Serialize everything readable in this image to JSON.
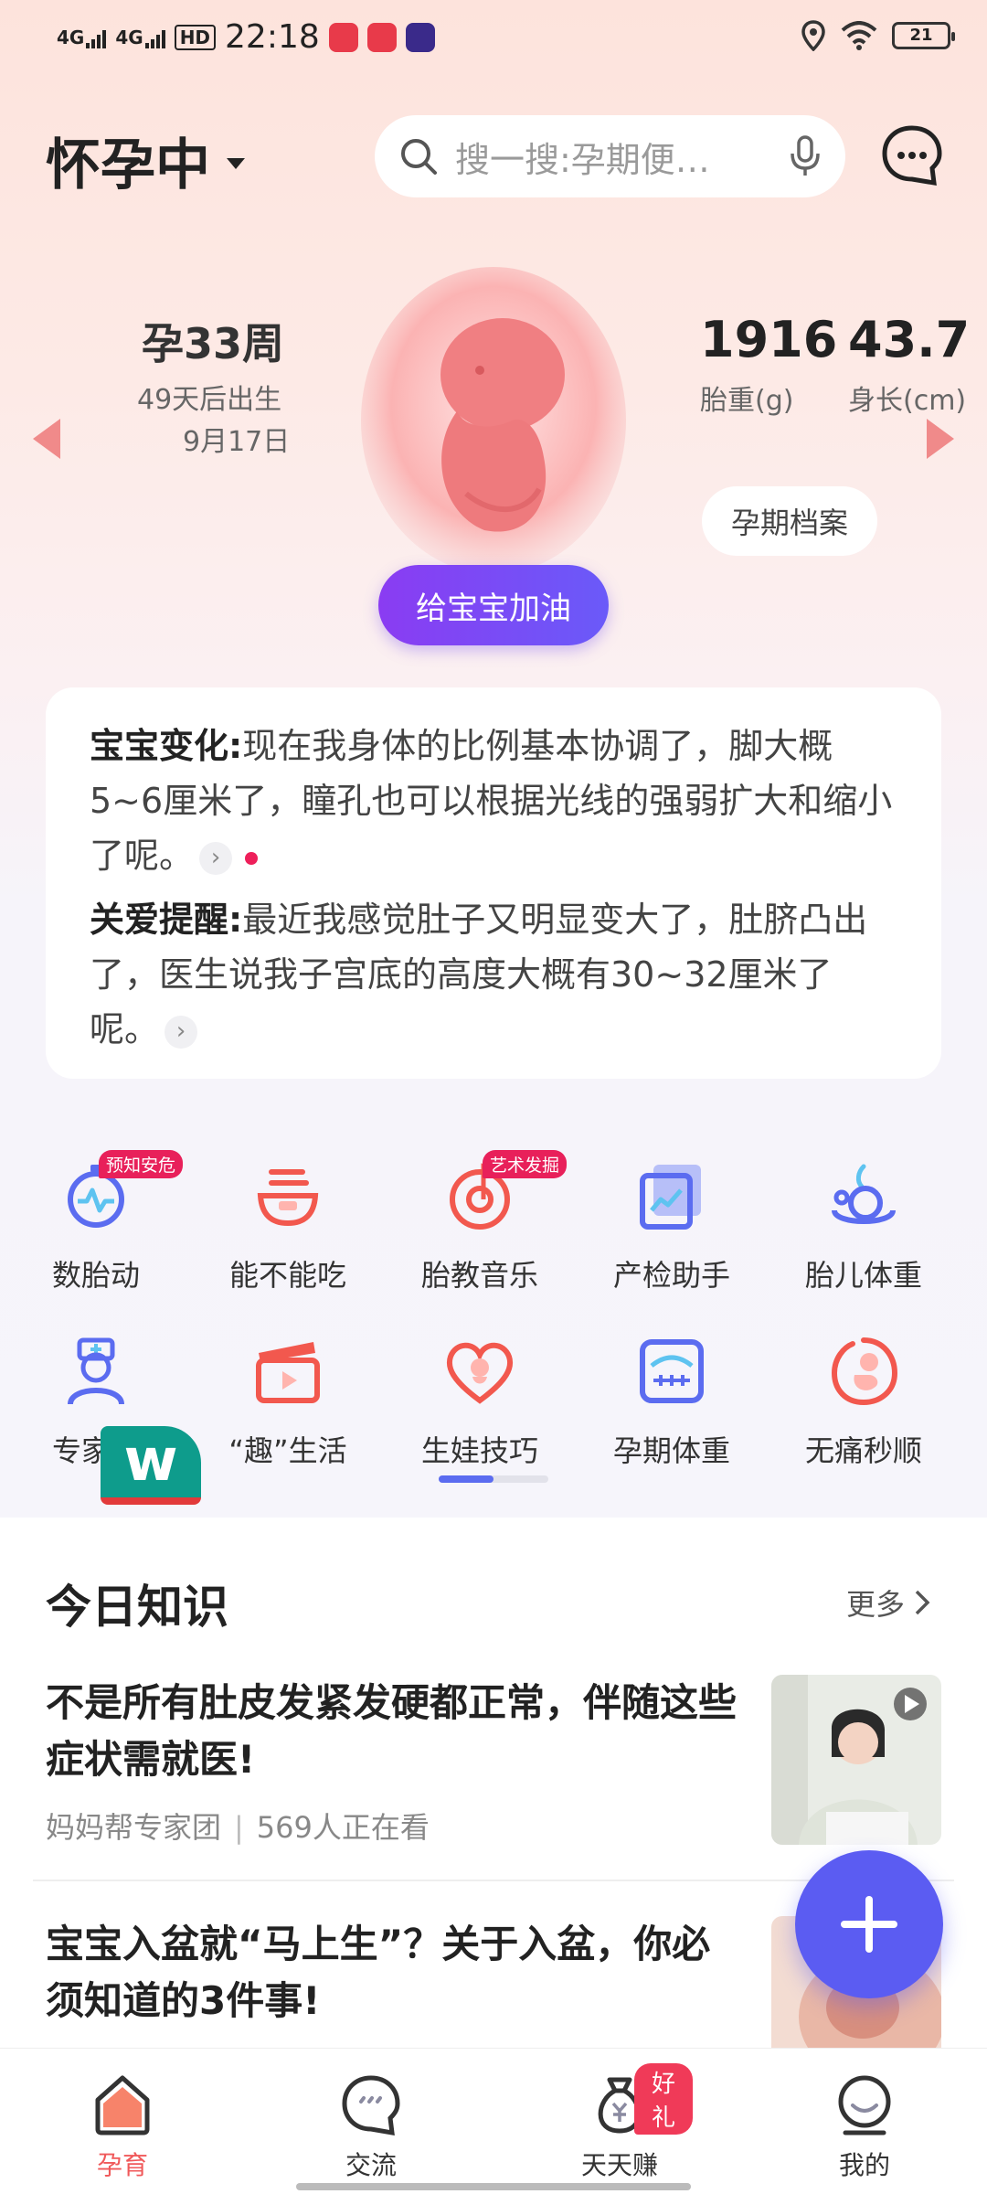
{
  "status_bar": {
    "sig1": "4G",
    "sig2": "4G",
    "hd": "HD",
    "time": "22:18",
    "battery": "21"
  },
  "header": {
    "stage": "怀孕中",
    "search_placeholder": "搜一搜:孕期便…"
  },
  "baby": {
    "week": "孕33周",
    "days_left": "49天后出生",
    "due_date": "9月17日",
    "weight_value": "1916",
    "weight_label": "胎重(g)",
    "length_value": "43.7",
    "length_label": "身长(cm)",
    "archive_button": "孕期档案",
    "cheer_button": "给宝宝加油"
  },
  "card": {
    "change_title": "宝宝变化:",
    "change_text": "现在我身体的比例基本协调了，脚大概5~6厘米了，瞳孔也可以根据光线的强弱扩大和缩小了呢。",
    "care_title": "关爱提醒:",
    "care_text": "最近我感觉肚子又明显变大了，肚脐凸出了，医生说我子宫底的高度大概有30~32厘米了呢。"
  },
  "tools": [
    {
      "label": "数胎动",
      "badge": "预知安危",
      "icon": "stopwatch-icon",
      "color": "#5b6cf0"
    },
    {
      "label": "能不能吃",
      "badge": "",
      "icon": "bowl-icon",
      "color": "#f2584e"
    },
    {
      "label": "胎教音乐",
      "badge": "艺术发掘",
      "icon": "music-disc-icon",
      "color": "#f2584e"
    },
    {
      "label": "产检助手",
      "badge": "",
      "icon": "report-chart-icon",
      "color": "#5b6cf0"
    },
    {
      "label": "胎儿体重",
      "badge": "",
      "icon": "fetus-scale-icon",
      "color": "#5b6cf0"
    },
    {
      "label": "专家说",
      "badge": "",
      "icon": "nurse-icon",
      "color": "#5b6cf0"
    },
    {
      "label": "“趣”生活",
      "badge": "",
      "icon": "clapper-icon",
      "color": "#f2584e"
    },
    {
      "label": "生娃技巧",
      "badge": "",
      "icon": "heart-baby-icon",
      "color": "#f2584e"
    },
    {
      "label": "孕期体重",
      "badge": "",
      "icon": "scale-icon",
      "color": "#5b6cf0"
    },
    {
      "label": "无痛秒顺",
      "badge": "",
      "icon": "fetus-icon",
      "color": "#f2584e"
    }
  ],
  "floating_logo": "w",
  "knowledge": {
    "title": "今日知识",
    "more": "更多",
    "articles": [
      {
        "title": "不是所有肚皮发紧发硬都正常，伴随这些症状需就医!",
        "source": "妈妈帮专家团",
        "views": "569人正在看"
      },
      {
        "title": "宝宝入盆就“马上生”？关于入盆，你必须知道的3件事!"
      }
    ]
  },
  "nav": {
    "items": [
      {
        "label": "孕育"
      },
      {
        "label": "交流"
      },
      {
        "label": "天天赚",
        "badge": "好礼"
      },
      {
        "label": "我的"
      }
    ]
  },
  "colors": {
    "accent": "#5b5cf2",
    "brand_red": "#f0595a",
    "cheer_start": "#8a3cf2"
  }
}
